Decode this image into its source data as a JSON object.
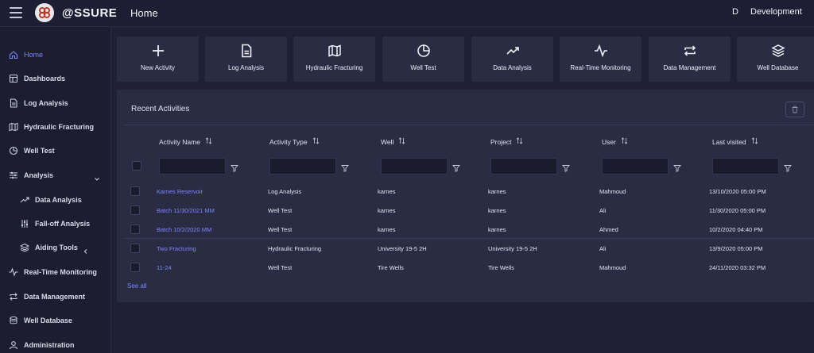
{
  "header": {
    "brand": "@SSURE",
    "page_title": "Home",
    "user_initial": "D",
    "environment": "Development"
  },
  "sidebar": {
    "items": [
      {
        "label": "Home",
        "icon": "home-icon"
      },
      {
        "label": "Dashboards",
        "icon": "dashboard-icon"
      },
      {
        "label": "Log Analysis",
        "icon": "document-icon"
      },
      {
        "label": "Hydraulic Fracturing",
        "icon": "map-icon"
      },
      {
        "label": "Well Test",
        "icon": "pie-chart-icon"
      },
      {
        "label": "Analysis",
        "icon": "sliders-icon"
      },
      {
        "label": "Data Analysis",
        "icon": "trend-icon"
      },
      {
        "label": "Fall-off Analysis",
        "icon": "tune-icon"
      },
      {
        "label": "Aiding Tools",
        "icon": "layers-icon"
      },
      {
        "label": "Real-Time Monitoring",
        "icon": "pulse-icon"
      },
      {
        "label": "Data Management",
        "icon": "repeat-icon"
      },
      {
        "label": "Well Database",
        "icon": "database-icon"
      },
      {
        "label": "Administration",
        "icon": "user-icon"
      }
    ]
  },
  "tiles": [
    {
      "label": "New Activity",
      "icon": "plus-icon"
    },
    {
      "label": "Log Analysis",
      "icon": "document-icon"
    },
    {
      "label": "Hydraulic Fracturing",
      "icon": "map-icon"
    },
    {
      "label": "Well Test",
      "icon": "pie-chart-icon"
    },
    {
      "label": "Data Analysis",
      "icon": "trend-icon"
    },
    {
      "label": "Real-Time Monitoring",
      "icon": "pulse-icon"
    },
    {
      "label": "Data Management",
      "icon": "repeat-icon"
    },
    {
      "label": "Well Database",
      "icon": "database-icon"
    }
  ],
  "recent": {
    "title": "Recent Activities",
    "columns": [
      "Activity Name",
      "Activity Type",
      "Well",
      "Project",
      "User",
      "Last visited"
    ],
    "rows": [
      [
        "Karnes Reservoir",
        "Log Analysis",
        "karnes",
        "karnes",
        "Mahmoud",
        "13/10/2020 05:00 PM"
      ],
      [
        "Batch 11/30/2021 MM",
        "Well Test",
        "karnes",
        "karnes",
        "Ali",
        "11/30/2020 05:00 PM"
      ],
      [
        "Batch 10/2/2020 MM",
        "Well Test",
        "karnes",
        "karnes",
        "Ahmed",
        "10/2/2020 04:40 PM"
      ],
      [
        "Two Fracturing",
        "Hydraulic Fracturing",
        "University 19-5 2H",
        "University 19-5 2H",
        "Ali",
        "13/9/2020 05:00 PM"
      ],
      [
        "11-24",
        "Well Test",
        "Tire Wells",
        "Tire Wells",
        "Mahmoud",
        "24/11/2020 03:32 PM"
      ]
    ],
    "see_all": "See all"
  },
  "colors": {
    "accent": "#7b86ff",
    "background": "#1f2036",
    "panel": "#2a2c44",
    "logo_red": "#c0392b"
  }
}
